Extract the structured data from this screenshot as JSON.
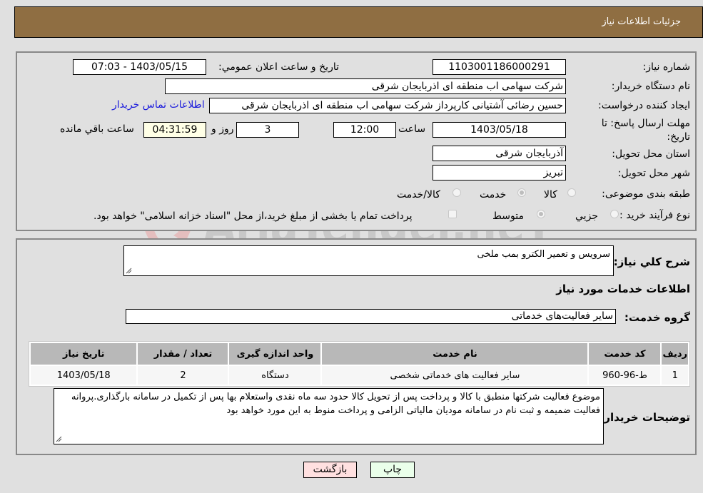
{
  "header": {
    "title": "جزئیات اطلاعات نیاز"
  },
  "details": {
    "need_number_label": "شماره نیاز:",
    "need_number": "1103001186000291",
    "announce_label": "تاریخ و ساعت اعلان عمومي:",
    "announce_value": "1403/05/15 - 07:03",
    "buyer_org_label": "نام دستگاه خریدار:",
    "buyer_org": "شرکت سهامی اب منطقه ای اذربایجان شرقی",
    "creator_label": "ایجاد کننده درخواست:",
    "creator": "حسین رضائی آشتیانی کارپرداز شرکت سهامی اب منطقه ای اذربایجان شرقی",
    "contact_link": "اطلاعات تماس خریدار",
    "deadline_label": "مهلت ارسال پاسخ: تا تاریخ:",
    "deadline_date": "1403/05/18",
    "time_label": "ساعت",
    "deadline_time": "12:00",
    "days_value": "3",
    "days_label": "روز و",
    "remaining_time": "04:31:59",
    "remaining_label": "ساعت باقي مانده",
    "province_label": "استان محل تحویل:",
    "province": "آذربایجان شرقی",
    "city_label": "شهر محل تحویل:",
    "city": "تبریز",
    "category_label": "طبقه بندی موضوعی:",
    "category_options": [
      "کالا",
      "خدمت",
      "کالا/خدمت"
    ],
    "category_selected": "خدمت",
    "process_label": "نوع فرآیند خرید :",
    "process_options": [
      "جزيي",
      "متوسط"
    ],
    "process_selected": "متوسط",
    "treasury_note": "پرداخت تمام یا بخشی از مبلغ خرید،از محل \"اسناد خزانه اسلامی\" خواهد بود."
  },
  "description": {
    "label": "شرح کلي نیاز:",
    "value": "سرویس و تعمیر الکترو بمب ملخی"
  },
  "services": {
    "section_title": "اطلاعات خدمات مورد نیاز",
    "group_label": "گروه خدمت:",
    "group_value": "سایر فعالیت‌های خدماتی",
    "table": {
      "headers": [
        "ردیف",
        "کد خدمت",
        "نام خدمت",
        "واحد اندازه گیری",
        "تعداد / مقدار",
        "تاریخ نیاز"
      ],
      "rows": [
        [
          "1",
          "ط-96-960",
          "سایر فعالیت های خدماتی شخصی",
          "دستگاه",
          "2",
          "1403/05/18"
        ]
      ]
    }
  },
  "buyer_notes": {
    "label": "توضیحات خریدار:",
    "value": "موضوع فعالیت شرکتها منطبق با کالا و پرداخت پس از تحویل کالا حدود سه  ماه نقدی واستعلام بها پس از تکمیل در سامانه بارگذاری.پروانه فعالیت ضمیمه و ثبت نام در سامانه مودیان مالیاتی الزامی و پرداخت منوط به این مورد خواهد بود"
  },
  "buttons": {
    "print": "چاپ",
    "back": "بازگشت"
  },
  "colors": {
    "header_bg": "#8f6e42",
    "link": "#1a1adc",
    "print_bg": "#eaffea",
    "back_bg": "#ffe0e0"
  },
  "watermark": {
    "text": "AriaTender.neT"
  }
}
